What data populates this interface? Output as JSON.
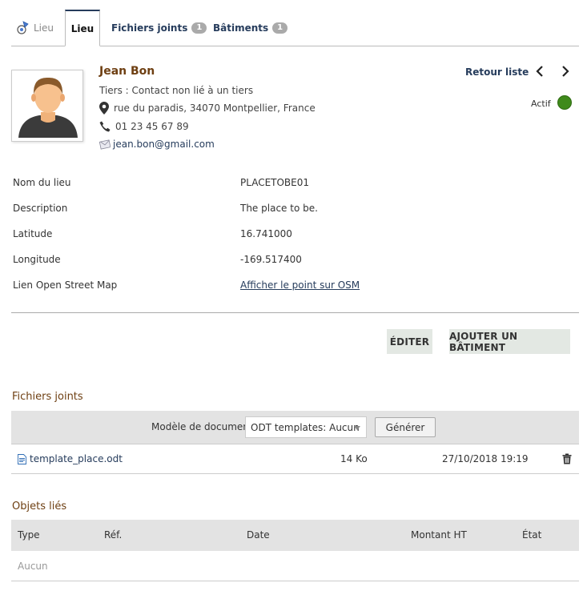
{
  "tabs": {
    "home_label": "Lieu",
    "active_label": "Lieu",
    "files_label": "Fichiers joints",
    "files_count": "1",
    "buildings_label": "Bâtiments",
    "buildings_count": "1"
  },
  "contact": {
    "name": "Jean Bon",
    "tiers": "Tiers : Contact non lié à un tiers",
    "address": "rue du paradis, 34070 Montpellier, France",
    "phone": "01 23 45 67 89",
    "email": "jean.bon@gmail.com"
  },
  "nav": {
    "back_label": "Retour liste",
    "status_label": "Actif",
    "status_color": "#3f8a1b"
  },
  "fields": [
    {
      "label": "Nom du lieu",
      "value": "PLACETOBE01"
    },
    {
      "label": "Description",
      "value": "The place to be."
    },
    {
      "label": "Latitude",
      "value": "16.741000"
    },
    {
      "label": "Longitude",
      "value": "-169.517400"
    },
    {
      "label": "Lien Open Street Map",
      "value": "Afficher le point sur OSM"
    }
  ],
  "actions": {
    "edit_label": "ÉDITER",
    "add_building_label": "AJOUTER UN BÂTIMENT"
  },
  "attachments": {
    "title": "Fichiers joints",
    "template_label": "Modèle de document",
    "template_selected": "ODT templates: Aucun",
    "generate_label": "Générer",
    "files": [
      {
        "name": "template_place.odt",
        "size": "14 Ko",
        "date": "27/10/2018 19:19"
      }
    ]
  },
  "linked_objects": {
    "title": "Objets liés",
    "columns": [
      "Type",
      "Réf.",
      "Date",
      "Montant HT",
      "État"
    ],
    "empty_label": "Aucun"
  },
  "colors": {
    "accent": "#263c5c",
    "section_title": "#6e3f12",
    "button_bg": "#e3e8e3"
  }
}
